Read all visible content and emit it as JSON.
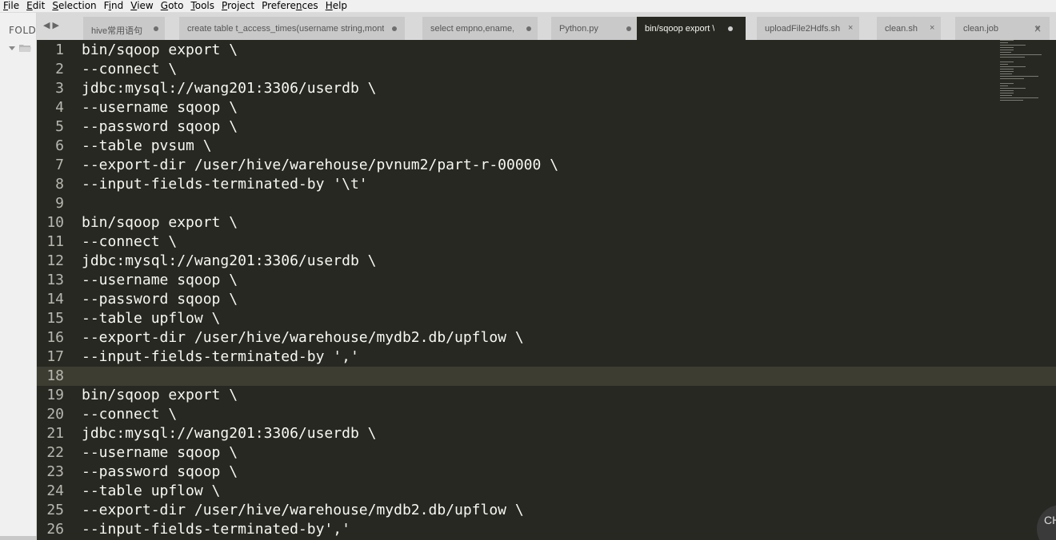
{
  "menubar": {
    "items": [
      {
        "pre": "",
        "ul": "F",
        "post": "ile"
      },
      {
        "pre": "",
        "ul": "E",
        "post": "dit"
      },
      {
        "pre": "",
        "ul": "S",
        "post": "election"
      },
      {
        "pre": "F",
        "ul": "i",
        "post": "nd"
      },
      {
        "pre": "",
        "ul": "V",
        "post": "iew"
      },
      {
        "pre": "",
        "ul": "G",
        "post": "oto"
      },
      {
        "pre": "",
        "ul": "T",
        "post": "ools"
      },
      {
        "pre": "",
        "ul": "P",
        "post": "roject"
      },
      {
        "pre": "Prefere",
        "ul": "n",
        "post": "ces"
      },
      {
        "pre": "",
        "ul": "H",
        "post": "elp"
      }
    ]
  },
  "sidebar": {
    "title": "FOLD"
  },
  "tabbar": {
    "nav_left": "◀",
    "nav_right": "▶",
    "tabs": [
      {
        "label": "hive常用语句",
        "state": "modified",
        "active": false
      },
      {
        "label": "create table t_access_times(username string,month",
        "state": "modified",
        "active": false
      },
      {
        "label": "select empno,ename,",
        "state": "modified",
        "active": false
      },
      {
        "label": "Python.py",
        "state": "modified",
        "active": false
      },
      {
        "label": "bin/sqoop export \\",
        "state": "modified",
        "active": true
      },
      {
        "label": "uploadFile2Hdfs.sh",
        "state": "close",
        "active": false
      },
      {
        "label": "clean.sh",
        "state": "close",
        "active": false
      },
      {
        "label": "clean.job",
        "state": "close",
        "active": false
      }
    ],
    "close_glyph": "×"
  },
  "editor": {
    "current_line": 18,
    "lines": [
      {
        "no": "1",
        "text": "bin/sqoop export \\"
      },
      {
        "no": "2",
        "text": "--connect \\"
      },
      {
        "no": "3",
        "text": "jdbc:mysql://wang201:3306/userdb \\"
      },
      {
        "no": "4",
        "text": "--username sqoop \\"
      },
      {
        "no": "5",
        "text": "--password sqoop \\"
      },
      {
        "no": "6",
        "text": "--table pvsum \\"
      },
      {
        "no": "7",
        "text": "--export-dir /user/hive/warehouse/pvnum2/part-r-00000 \\"
      },
      {
        "no": "8",
        "text": "--input-fields-terminated-by '\\t'"
      },
      {
        "no": "9",
        "text": ""
      },
      {
        "no": "10",
        "text": "bin/sqoop export \\"
      },
      {
        "no": "11",
        "text": "--connect \\"
      },
      {
        "no": "12",
        "text": "jdbc:mysql://wang201:3306/userdb \\"
      },
      {
        "no": "13",
        "text": "--username sqoop \\"
      },
      {
        "no": "14",
        "text": "--password sqoop \\"
      },
      {
        "no": "15",
        "text": "--table upflow \\"
      },
      {
        "no": "16",
        "text": "--export-dir /user/hive/warehouse/mydb2.db/upflow \\"
      },
      {
        "no": "17",
        "text": "--input-fields-terminated-by ','"
      },
      {
        "no": "18",
        "text": ""
      },
      {
        "no": "19",
        "text": "bin/sqoop export \\"
      },
      {
        "no": "20",
        "text": "--connect \\"
      },
      {
        "no": "21",
        "text": "jdbc:mysql://wang201:3306/userdb \\"
      },
      {
        "no": "22",
        "text": "--username sqoop \\"
      },
      {
        "no": "23",
        "text": "--password sqoop \\"
      },
      {
        "no": "24",
        "text": "--table upflow \\"
      },
      {
        "no": "25",
        "text": "--export-dir /user/hive/warehouse/mydb2.db/upflow \\"
      },
      {
        "no": "26",
        "text": "--input-fields-terminated-by','"
      }
    ]
  },
  "overlay": {
    "text": "CH"
  },
  "colors": {
    "editor_bg": "#272822",
    "text": "#f8f8f2",
    "line_numbers": "#b8b8b0",
    "current_line": "#3e3d32",
    "tab_inactive": "#c9c9c9",
    "tabbar_bg": "#d9d9d9"
  }
}
